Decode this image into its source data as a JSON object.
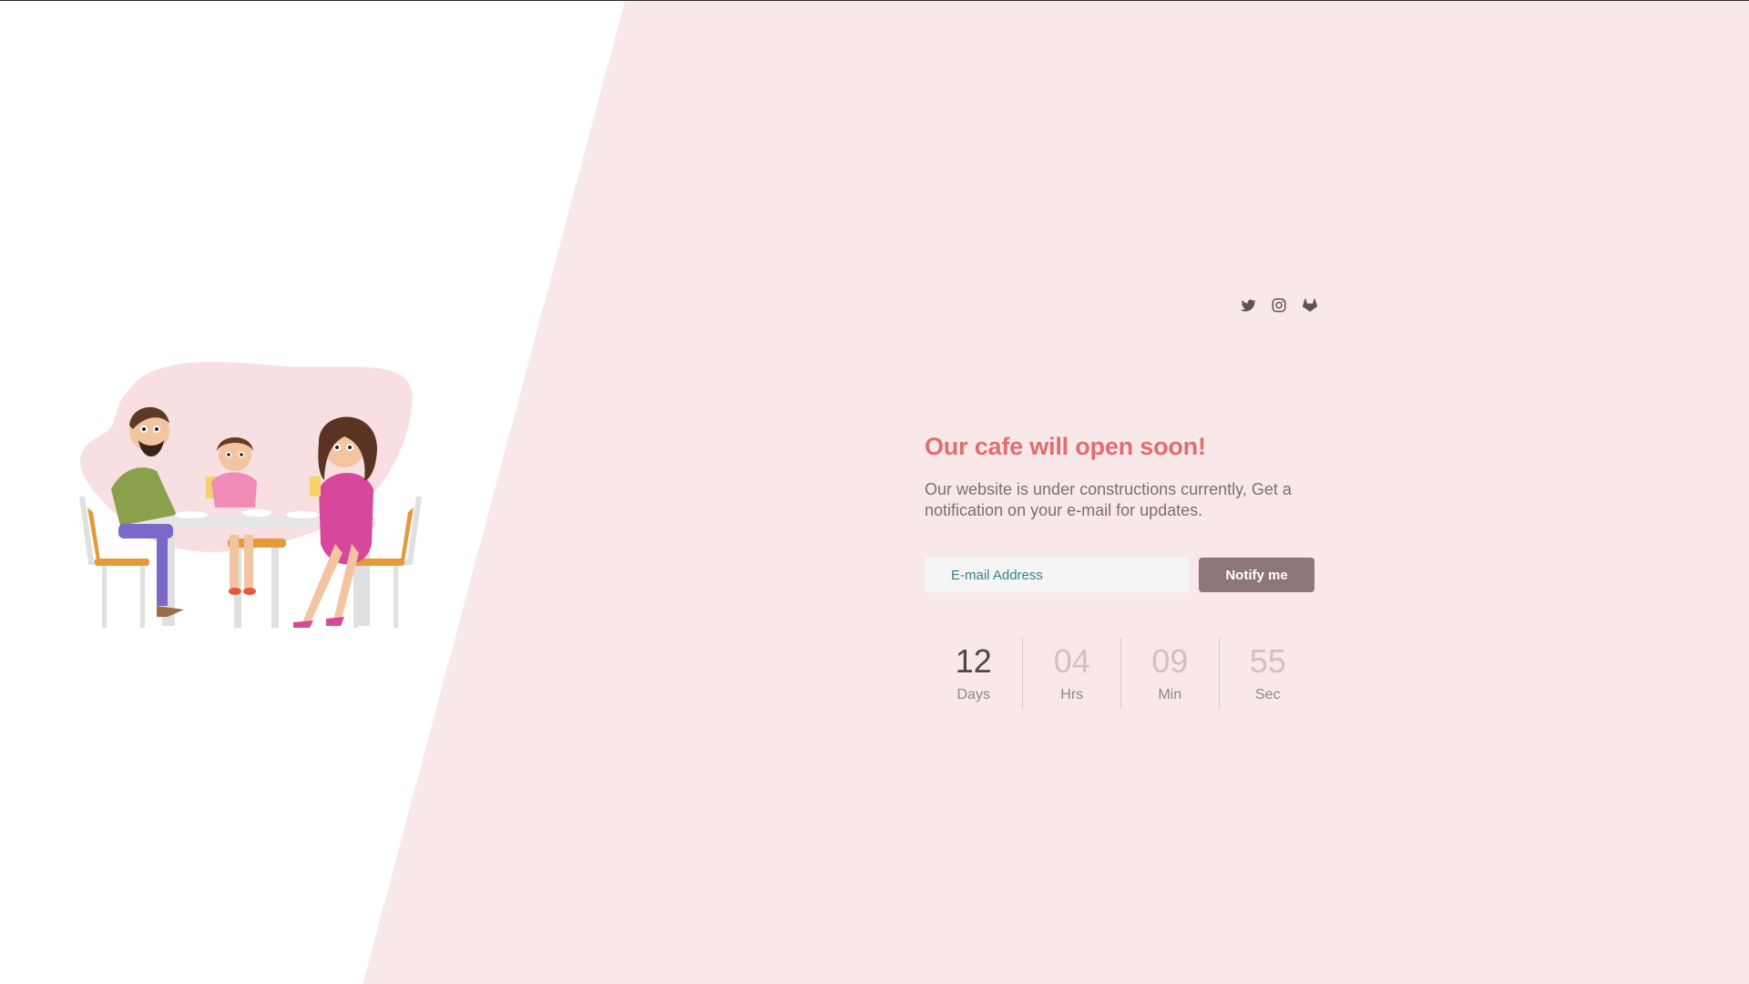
{
  "social": {
    "icons": [
      "twitter-icon",
      "instagram-icon",
      "gitlab-icon"
    ],
    "icon_color": "#5a5555"
  },
  "hero": {
    "title": "Our cafe will open soon!",
    "description": "Our website is under constructions currently, Get a notification on your e-mail for updates."
  },
  "form": {
    "email_placeholder": "E-mail Address",
    "email_value": "",
    "button_label": "Notify me"
  },
  "countdown": [
    {
      "value": "12",
      "label": "Days"
    },
    {
      "value": "04",
      "label": "Hrs"
    },
    {
      "value": "09",
      "label": "Min"
    },
    {
      "value": "55",
      "label": "Sec"
    }
  ],
  "colors": {
    "accent": "#e06e6e",
    "background_pink": "#f8e8e9",
    "button": "#8d7679"
  }
}
